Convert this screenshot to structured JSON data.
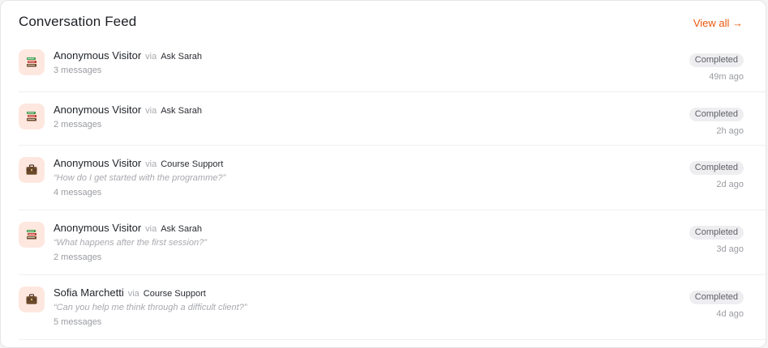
{
  "feed": {
    "title": "Conversation Feed",
    "view_all_label": "View all →",
    "via_label": "via",
    "accent_color": "#ea580c",
    "items": [
      {
        "icon": "books-icon",
        "name": "Anonymous Visitor",
        "agent": "Ask Sarah",
        "quote": "",
        "messages": "3 messages",
        "status": "Completed",
        "time": "49m ago"
      },
      {
        "icon": "books-icon",
        "name": "Anonymous Visitor",
        "agent": "Ask Sarah",
        "quote": "",
        "messages": "2 messages",
        "status": "Completed",
        "time": "2h ago"
      },
      {
        "icon": "briefcase-icon",
        "name": "Anonymous Visitor",
        "agent": "Course Support",
        "quote": "“How do I get started with the programme?”",
        "messages": "4 messages",
        "status": "Completed",
        "time": "2d ago"
      },
      {
        "icon": "books-icon",
        "name": "Anonymous Visitor",
        "agent": "Ask Sarah",
        "quote": "“What happens after the first session?”",
        "messages": "2 messages",
        "status": "Completed",
        "time": "3d ago"
      },
      {
        "icon": "briefcase-icon",
        "name": "Sofia Marchetti",
        "agent": "Course Support",
        "quote": "“Can you help me think through a difficult client?”",
        "messages": "5 messages",
        "status": "Completed",
        "time": "4d ago"
      }
    ]
  }
}
